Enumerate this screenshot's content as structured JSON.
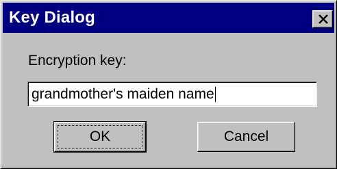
{
  "window": {
    "title": "Key Dialog",
    "close_icon": "close-icon"
  },
  "form": {
    "label": "Encryption key:",
    "key_value": "grandmother's maiden name"
  },
  "buttons": {
    "ok_label": "OK",
    "cancel_label": "Cancel"
  },
  "colors": {
    "titlebar": "#000080",
    "dialog_face": "#c0c0c0",
    "input_background": "#ffffff"
  }
}
